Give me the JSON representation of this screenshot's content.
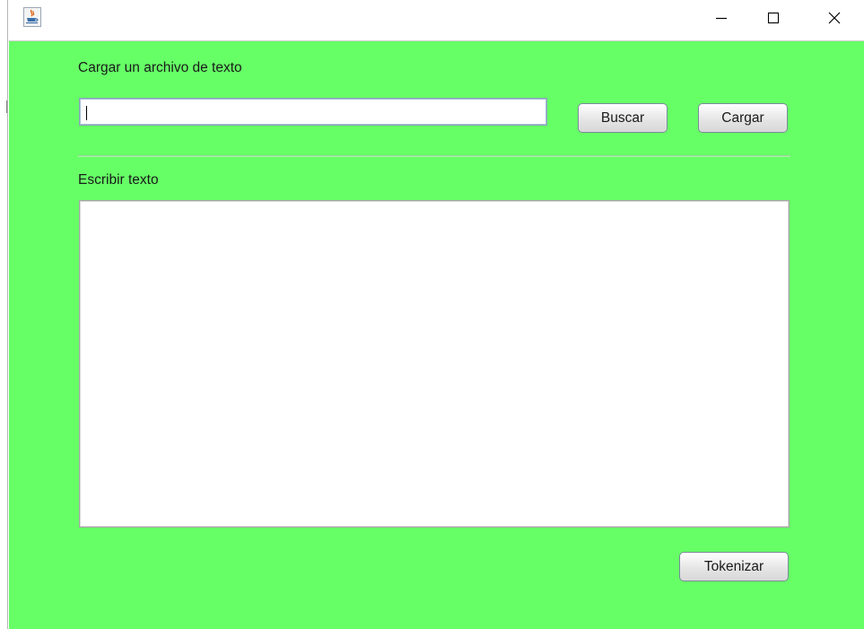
{
  "window": {
    "icon": "java-coffee-icon",
    "controls": {
      "minimize_glyph": "—",
      "maximize_glyph": "☐",
      "close_glyph": "✕"
    }
  },
  "colors": {
    "background": "#66ff66",
    "button_border": "#7a8a9a",
    "field_border": "#8aa0b8"
  },
  "load_section": {
    "label": "Cargar un archivo de texto",
    "path_value": "",
    "path_placeholder": "",
    "browse_button": "Buscar",
    "load_button": "Cargar"
  },
  "write_section": {
    "label": "Escribir texto",
    "text_value": ""
  },
  "actions": {
    "tokenize_button": "Tokenizar"
  }
}
